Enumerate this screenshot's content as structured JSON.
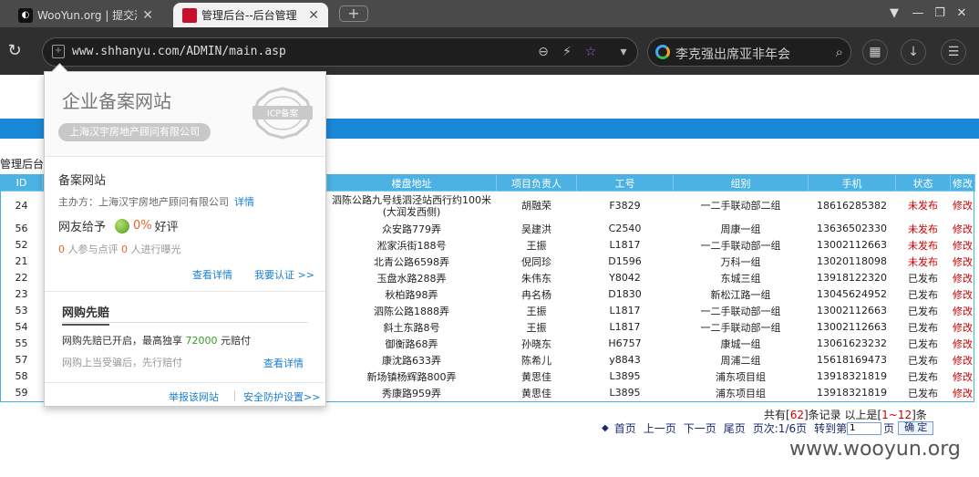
{
  "browser": {
    "tabs": [
      {
        "title": "WooYun.org | 提交漏洞"
      },
      {
        "title": "管理后台--后台管理"
      }
    ],
    "new_tab": "+",
    "url": "www.shhanyu.com/ADMIN/main.asp",
    "search_query": "李克强出席亚非年会"
  },
  "page": {
    "title": "管理后台",
    "table": {
      "headers": [
        "ID",
        "",
        "",
        "",
        "楼盘地址",
        "项目负责人",
        "工号",
        "组别",
        "手机",
        "状态",
        "修改"
      ],
      "rows": [
        [
          "24",
          "泗陈公路九号线泗泾站西行约100米(大润发西侧)",
          "胡融荣",
          "F3829",
          "一二手联动部二组",
          "18616285382",
          "未发布",
          "修改"
        ],
        [
          "56",
          "众安路779弄",
          "吴建洪",
          "C2540",
          "周康一组",
          "13636502330",
          "未发布",
          "修改"
        ],
        [
          "52",
          "淞家浜街188号",
          "王振",
          "L1817",
          "一二手联动部一组",
          "13002112663",
          "未发布",
          "修改"
        ],
        [
          "21",
          "北青公路6598弄",
          "倪同珍",
          "D1596",
          "万科一组",
          "13020118098",
          "未发布",
          "修改"
        ],
        [
          "22",
          "玉盘水路288弄",
          "朱伟东",
          "Y8042",
          "东城三组",
          "13918122320",
          "已发布",
          "修改"
        ],
        [
          "23",
          "秋柏路98弄",
          "冉名杨",
          "D1830",
          "新松江路一组",
          "13045624952",
          "已发布",
          "修改"
        ],
        [
          "53",
          "泗陈公路1888弄",
          "王振",
          "L1817",
          "一二手联动部一组",
          "13002112663",
          "已发布",
          "修改"
        ],
        [
          "54",
          "斜土东路8号",
          "王振",
          "L1817",
          "一二手联动部一组",
          "13002112663",
          "已发布",
          "修改"
        ],
        [
          "55",
          "御衡路68弄",
          "孙晓东",
          "H6757",
          "康城一组",
          "13061623232",
          "已发布",
          "修改"
        ],
        [
          "57",
          "康沈路633弄",
          "陈希儿",
          "y8843",
          "周浦二组",
          "15618169473",
          "已发布",
          "修改"
        ],
        [
          "58",
          "新场镇杨辉路800弄",
          "黄思佳",
          "L3895",
          "浦东项目组",
          "13918321819",
          "已发布",
          "修改"
        ],
        [
          "59",
          "秀康路959弄",
          "黄思佳",
          "L3895",
          "浦东项目组",
          "13918321819",
          "已发布",
          "修改"
        ]
      ]
    },
    "pager": {
      "total_prefix": "共有[",
      "total": "62",
      "total_mid": "]条记录 以上是[",
      "range": "1~12",
      "total_suffix": "]条",
      "first": "首页",
      "prev": "上一页",
      "next": "下一页",
      "last": "尾页",
      "page_info": "页次:1/6页",
      "goto_label": "转到第",
      "goto_value": "1",
      "goto_unit": "页",
      "confirm": "确 定"
    },
    "watermark": "www.wooyun.org"
  },
  "popup": {
    "title": "企业备案网站",
    "company": "上海汉宇房地产顾问有限公司",
    "seal_text": "ICP备案",
    "section1_title": "备案网站",
    "owner_label": "主办方：上海汉宇房地产顾问有限公司",
    "detail_link": "详情",
    "rating_prefix": "网友给予",
    "rating_pct": "0%",
    "rating_suffix": "好评",
    "review_count": "0",
    "review_mid": "人参与点评",
    "expose_count": "0",
    "expose_suffix": "人进行曝光",
    "view_details": "查看详情",
    "certify": "我要认证 >>",
    "section2_title": "网购先赔",
    "guarantee_prefix": "网购先赔已开启，最高独享",
    "guarantee_amount": "72000",
    "guarantee_suffix": "元赔付",
    "guarantee_note": "网购上当受骗后，先行赔付",
    "view_details2": "查看详情",
    "report": "举报该网站",
    "security": "安全防护设置>>"
  },
  "colors": {
    "header_blue": "#4bb2e3",
    "status_unpublished": "#cc0000",
    "link_blue": "#1a7fd0"
  }
}
